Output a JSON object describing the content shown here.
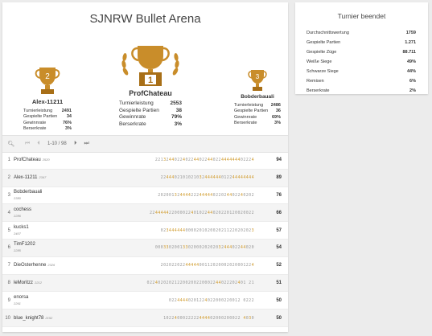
{
  "arena": {
    "title": "SJNRW Bullet Arena"
  },
  "podium": {
    "first": {
      "rank": "1",
      "name": "ProfChateau",
      "stats": [
        {
          "label": "Turnierleistung",
          "value": "2553"
        },
        {
          "label": "Gespielte Partien",
          "value": "38"
        },
        {
          "label": "Gewinnrate",
          "value": "79%"
        },
        {
          "label": "Berserkrate",
          "value": "3%"
        }
      ]
    },
    "second": {
      "rank": "2",
      "name": "Alex-11211",
      "stats": [
        {
          "label": "Turnierleistung",
          "value": "2491"
        },
        {
          "label": "Gespielte Partien",
          "value": "34"
        },
        {
          "label": "Gewinnrate",
          "value": "76%"
        },
        {
          "label": "Berserkrate",
          "value": "3%"
        }
      ]
    },
    "third": {
      "rank": "3",
      "name": "Bobderbauali",
      "stats": [
        {
          "label": "Turnierleistung",
          "value": "2486"
        },
        {
          "label": "Gespielte Partien",
          "value": "36"
        },
        {
          "label": "Gewinnrate",
          "value": "69%"
        },
        {
          "label": "Berserkrate",
          "value": "3%"
        }
      ]
    }
  },
  "pager": {
    "range": "1-10 / 98"
  },
  "standings": [
    {
      "rank": "1",
      "name": "ProfChateau",
      "rating": "2520",
      "seq": "221324402240224402244022444444402224",
      "score": "94"
    },
    {
      "rank": "2",
      "name": "Alex-11211",
      "rating": "2347",
      "seq": "2244402101021032444444012244444444",
      "score": "89"
    },
    {
      "rank": "3",
      "name": "Bobderbauali",
      "rating": "2380",
      "seq": "20200132444422244444022024402240202",
      "score": "76"
    },
    {
      "rank": "4",
      "name": "cochess",
      "rating": "2286",
      "seq": "22444442200002240102244020220120020022",
      "score": "66"
    },
    {
      "rank": "5",
      "name": "kucks1",
      "rating": "2407",
      "seq": "0234444440000201020020211220202023",
      "score": "57"
    },
    {
      "rank": "6",
      "name": "TimF1202",
      "rating": "2285",
      "seq": "000330200133020002020203244402244020",
      "score": "54"
    },
    {
      "rank": "7",
      "name": "DieOsterhenne",
      "rating": "2326",
      "seq": "2020220224444400112020002020001224",
      "score": "52"
    },
    {
      "rank": "8",
      "name": "leMoritzz",
      "rating": "2212",
      "seq": "022402020212200200220002244022202401 21",
      "score": "51"
    },
    {
      "rank": "9",
      "name": "enorsa",
      "rating": "2261",
      "seq": "02244440201224022000220012 0222",
      "score": "50"
    },
    {
      "rank": "10",
      "name": "blue_knight78",
      "rating": "2152",
      "seq": "1022400022222444402000200022 4030",
      "score": "50"
    }
  ],
  "summary": {
    "title": "Turnier beendet",
    "rows": [
      {
        "label": "Durchschnittswertung",
        "value": "1759"
      },
      {
        "label": "Gespielte Partien",
        "value": "1.271"
      },
      {
        "label": "Gespielte Züge",
        "value": "88.711"
      },
      {
        "label": "Weiße Siege",
        "value": "49%"
      },
      {
        "label": "Schwarze Siege",
        "value": "44%"
      },
      {
        "label": "Remisen",
        "value": "6%"
      },
      {
        "label": "Berserkrate",
        "value": "2%"
      }
    ]
  },
  "colors": {
    "trophy": "#c98d2a",
    "trophy_dark": "#a86f17",
    "hot": "#d09a2a"
  }
}
